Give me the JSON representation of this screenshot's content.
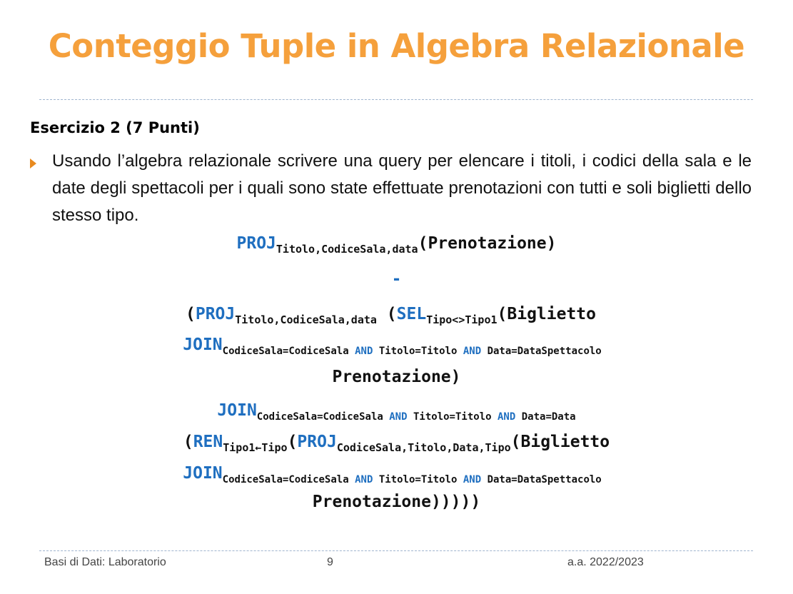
{
  "slide": {
    "title": "Conteggio Tuple in Algebra Relazionale",
    "heading": "Esercizio 2 (7 Punti)",
    "bullet_text": "Usando l’algebra relazionale scrivere una query per elencare i titoli, i codici della sala e le date degli spettacoli per i quali sono state effettuate prenotazioni con tutti e soli biglietti dello stesso tipo."
  },
  "query": {
    "proj": "PROJ",
    "sel": "SEL",
    "join": "JOIN",
    "ren": "REN",
    "and": "AND",
    "minus": "-",
    "proj1_attrs": "Titolo,CodiceSala,data",
    "proj1_arg": "(Prenotazione)",
    "open_paren": "(",
    "proj2_attrs": "Titolo,CodiceSala,data",
    "sel_cond": "Tipo<>Tipo1",
    "biglietto_open": "(Biglietto",
    "cond_codice": "CodiceSala=CodiceSala",
    "cond_titolo": "Titolo=Titolo",
    "cond_data_spett": "Data=DataSpettacolo",
    "cond_data": "Data=Data",
    "prenotazione_close1": "Prenotazione)",
    "ren_attrs": "Tipo1←Tipo",
    "proj3_attrs": "CodiceSala,Titolo,Data,Tipo",
    "prenotazione_close_final": "Prenotazione)))))"
  },
  "footer": {
    "left": "Basi di Dati: Laboratorio",
    "page": "9",
    "right": "a.a.  2022/2023"
  }
}
